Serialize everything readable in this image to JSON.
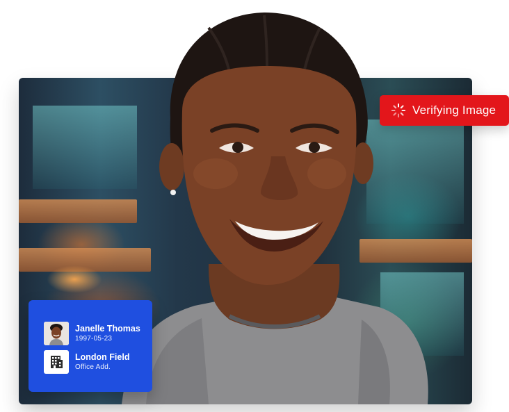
{
  "badge": {
    "label": "Verifying Image",
    "color": "#e3161b",
    "icon": "loading-spinner-icon"
  },
  "identity_card": {
    "color": "#1f4fe0",
    "person": {
      "name": "Janelle Thomas",
      "date": "1997-05-23",
      "icon": "avatar-thumbnail"
    },
    "location": {
      "name": "London Field",
      "detail": "Office Add.",
      "icon": "building-icon"
    }
  }
}
